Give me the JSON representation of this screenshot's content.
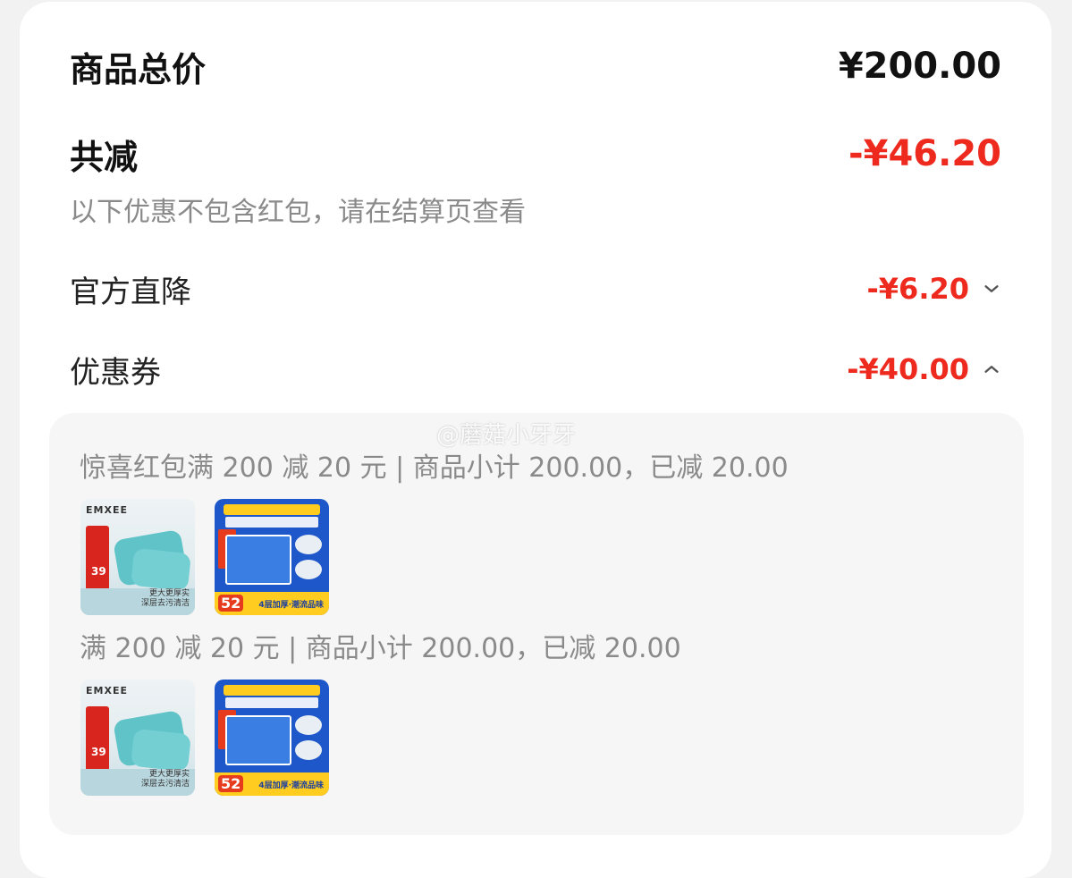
{
  "summary": {
    "total_label": "商品总价",
    "total_value": "¥200.00",
    "reduce_label": "共减",
    "reduce_value": "-¥46.20",
    "reduce_note": "以下优惠不包含红包，请在结算页查看"
  },
  "lines": [
    {
      "label": "官方直降",
      "value": "-¥6.20",
      "expanded": false,
      "icon": "chevron-down-icon"
    },
    {
      "label": "优惠券",
      "value": "-¥40.00",
      "expanded": true,
      "icon": "chevron-up-icon"
    }
  ],
  "coupons": [
    {
      "text": "惊喜红包满 200 减 20 元 | 商品小计 200.00，已减 20.00",
      "products": [
        "wipes-product-thumbnail",
        "tissue-product-thumbnail"
      ]
    },
    {
      "text": "满 200 减 20 元 | 商品小计 200.00，已减 20.00",
      "products": [
        "wipes-product-thumbnail",
        "tissue-product-thumbnail"
      ]
    }
  ],
  "products": {
    "wipes": {
      "brand": "EMXEE",
      "price": "39",
      "caption_line1": "更大更厚实",
      "caption_line2": "深层去污清洁"
    },
    "tissue": {
      "badge": "52",
      "tag": "4层加厚·潮流品味"
    }
  },
  "watermark": "@蘑菇小牙牙",
  "colors": {
    "accent_red": "#ee2a1f",
    "text_dark": "#111111",
    "text_muted": "#8a8a8a",
    "panel_bg": "#f6f6f6"
  }
}
